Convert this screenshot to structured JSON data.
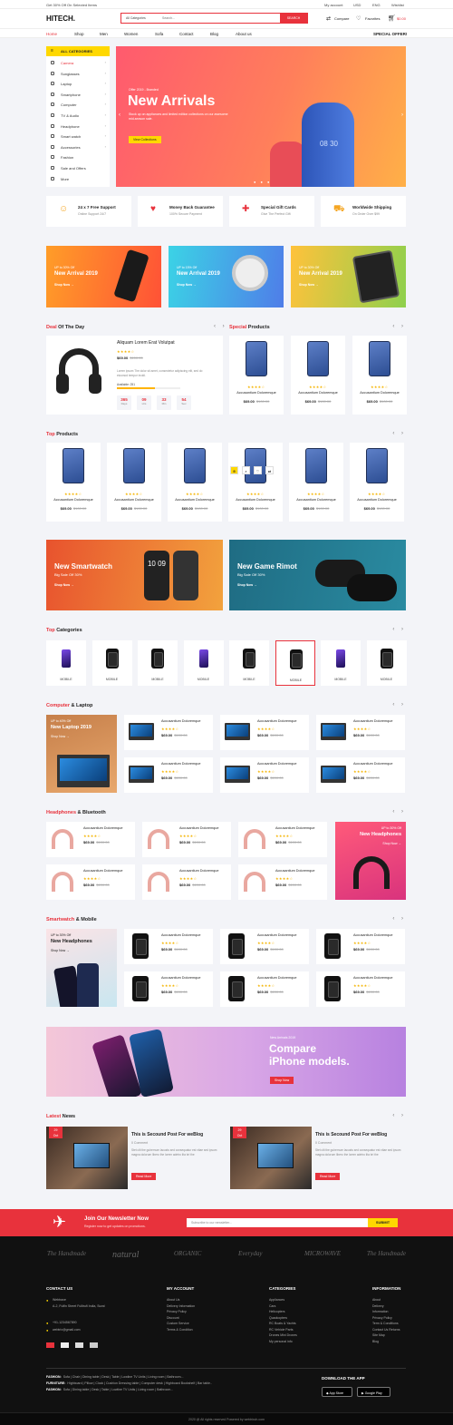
{
  "topbar": {
    "promo": "Get 30% Off On Selected Items",
    "links": [
      "My account",
      "USD",
      "ENG",
      "Wishlist"
    ]
  },
  "header": {
    "logo": "HITECH.",
    "category": "All Categories",
    "search_placeholder": "Search...",
    "search_btn": "SEARCH",
    "compare": "Compare",
    "favorites": "Favorites",
    "cart": "$0.00"
  },
  "nav": {
    "items": [
      "Home",
      "Shop",
      "Men",
      "Women",
      "Sofa",
      "Contact",
      "Blog",
      "About us"
    ],
    "special": "SPECIAL OFFER!"
  },
  "sidebar": {
    "title": "ALL CATEGORIES",
    "items": [
      "Camera",
      "Sunglasses",
      "Laptop",
      "Smartphone",
      "Computer",
      "TV & Audio",
      "Headphone",
      "Smart watch",
      "Accessories",
      "Fashion",
      "Sale and Offers",
      "More"
    ]
  },
  "hero": {
    "kicker": "Offer 2019 - Branded",
    "title": "New Arrivals",
    "desc": "Stock up on appliances and limited edition collections on our awesome mid-season sale.",
    "btn": "View Collections",
    "display": "08 30"
  },
  "services": [
    {
      "title": "24 x 7 Free Support",
      "sub": "Online Support 24/7"
    },
    {
      "title": "Money Back Guarantee",
      "sub": "100% Secure Payment"
    },
    {
      "title": "Special Gift Cards",
      "sub": "Give The Perfect Gift"
    },
    {
      "title": "Worldwide Shipping",
      "sub": "On Order Over $99"
    }
  ],
  "promos": [
    {
      "off": "UP to 30% Off",
      "title": "New Arrival 2019",
      "btn": "Shop Now →"
    },
    {
      "off": "UP to 15% Off",
      "title": "New Arrival 2019",
      "btn": "Shop Now →"
    },
    {
      "off": "UP to 30% Off",
      "title": "New Arrival 2019",
      "btn": "Shop Now →"
    }
  ],
  "deal": {
    "title1": "Deal",
    "title2": " Of The Day",
    "name": "Aliquam Lorem Erat Volutpat",
    "price": "$69.00",
    "old": "$100.00",
    "desc": "Lorem ipsum The dolor sit amet, consectetur adipiscing elit, sed do eiusmod tempor incidi.",
    "available": "Available: 251",
    "countdown": [
      {
        "n": "365",
        "l": "Days"
      },
      {
        "n": "09",
        "l": "Hrs"
      },
      {
        "n": "33",
        "l": "Min"
      },
      {
        "n": "54",
        "l": "Sec"
      }
    ]
  },
  "special": {
    "title1": "Special",
    "title2": " Products"
  },
  "product": {
    "name": "Accusantium Doloremque",
    "price": "$69.00",
    "old": "$100.00",
    "stars": "★★★★☆"
  },
  "top_products": {
    "title1": "Top",
    "title2": " Products"
  },
  "banners2": [
    {
      "title": "New Smartwatch",
      "sub": "Big Sale Off 30%",
      "btn": "Shop Now →",
      "time": "10 09"
    },
    {
      "title": "New Game Rimot",
      "sub": "Big Sale Off 30%",
      "btn": "Shop Now →"
    }
  ],
  "top_categories": {
    "title1": "Top",
    "title2": " Categories",
    "items": [
      "MOBILE",
      "MOBILE",
      "MOBILE",
      "MOBILE",
      "MOBILE",
      "MOBILE",
      "MOBILE",
      "MOBILE"
    ]
  },
  "computer": {
    "title1": "Computer",
    "title2": " & Laptop",
    "off": "UP to 40% Off",
    "promo": "New Laptop 2019",
    "btn": "Shop Now →"
  },
  "headphones": {
    "title1": "Headphones",
    "title2": " & Bluetooth",
    "off": "UP to 30% Off",
    "promo": "New Headphones",
    "btn": "Shop Now →"
  },
  "smartwatch": {
    "title1": "Smartwatch",
    "title2": " & Mobile",
    "off": "UP to 30% Off",
    "promo": "New Headphones",
    "btn": "Shop Now →"
  },
  "iphone": {
    "kicker": "New Arrivals 2019",
    "title1": "Compare",
    "title2": "iPhone models.",
    "btn": "Shop Now"
  },
  "news": {
    "title1": "Latest",
    "title2": " News",
    "posts": [
      {
        "day": "29",
        "mon": "Oct",
        "title": "This is Secound Post For weBlog",
        "comments": "0 Comment",
        "text": "Stet clit the gubernum lacusts sed consequatur est vitae sed ipsum magna dolorum libero the lorem adetro lita bri the",
        "btn": "Read More"
      },
      {
        "day": "29",
        "mon": "Oct",
        "title": "This is Secound Post For weBlog",
        "comments": "0 Comment",
        "text": "Stet clit the gubernum lacusts sed consequatur est vitae sed ipsum magna dolorum libero the lorem adetro lita bri the",
        "btn": "Read More"
      }
    ]
  },
  "newsletter": {
    "title": "Join Our Newsletter Now",
    "sub": "Register now to get updates on promotions.",
    "placeholder": "Subscribe to our newsletter...",
    "btn": "SUBMIT"
  },
  "brands": [
    "The Handmade",
    "natural",
    "ORGANIC",
    "Everyday",
    "MICROWAVE",
    "The Handmade"
  ],
  "footer": {
    "contact_title": "CONTACT US",
    "address": "Webtraxe",
    "addr2": "A-2, Fulfin Street Fulltrufi India, Surat",
    "phone": "+91-1234567890",
    "email": "webtrix@gmail.com",
    "account_title": "MY ACCOUNT",
    "account": [
      "About Us",
      "Delivery Information",
      "Privacy Policy",
      "Discount",
      "Custom Service",
      "Terms & Condition"
    ],
    "cat_title": "CATEGORIES",
    "cats": [
      "Appliances",
      "Cars",
      "Helicopters",
      "Quadcopters",
      "RC Boats & Yachts",
      "RC Vehicle Parts",
      "Drones Mini Drones",
      "My personal info"
    ],
    "info_title": "INFORMATION",
    "info": [
      "About",
      "Delivery",
      "Information",
      "Privacy Policy",
      "Term & Conditions",
      "Contact Us Returns",
      "Site Map",
      "Blog"
    ],
    "tags": [
      {
        "k": "FASHION:",
        "v": "Sofa | Chair | Dining table | Desk | Table | Lowline TV Units | Living room | Bathroom..."
      },
      {
        "k": "FURNITURE:",
        "v": "Highboard | Pillow | Clock | Cushion Dressing table | Computer desk | Highboard Bookshelf | Bar table.."
      },
      {
        "k": "FASHION:",
        "v": "Sofa | Dining table | Desk | Table | Lowline TV Units | Living room | Bathroom..."
      }
    ],
    "app_title": "DOWNLOAD THE APP",
    "appstore": "App Store",
    "gplay": "Google Play",
    "copyright": "2020 @ All rights reserved Powered by webtrixch.com"
  }
}
